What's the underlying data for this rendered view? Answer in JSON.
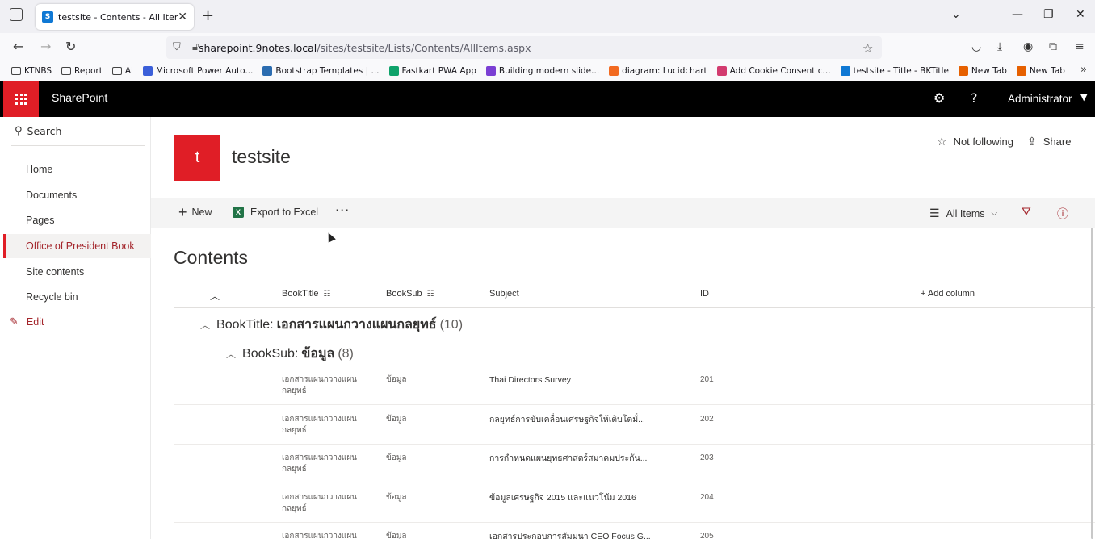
{
  "browser": {
    "tab_title": "testsite - Contents - All Items",
    "url_host": "sharepoint.9notes.local",
    "url_path": "/sites/testsite/Lists/Contents/AllItems.aspx",
    "bookmarks": [
      {
        "label": "KTNBS",
        "icon": "folder-icon",
        "color": ""
      },
      {
        "label": "Report",
        "icon": "folder-icon",
        "color": ""
      },
      {
        "label": "Ai",
        "icon": "folder-icon",
        "color": ""
      },
      {
        "label": "Microsoft Power Auto...",
        "icon": "power-automate-icon",
        "color": "#3b5fd9"
      },
      {
        "label": "Bootstrap Templates | ...",
        "icon": "bootstrap-icon",
        "color": "#2b6cb0"
      },
      {
        "label": "Fastkart PWA App",
        "icon": "fastkart-icon",
        "color": "#0fa36b"
      },
      {
        "label": "Building modern slide...",
        "icon": "slides-icon",
        "color": "#7b3fd4"
      },
      {
        "label": "diagram: Lucidchart",
        "icon": "lucidchart-icon",
        "color": "#f26a21"
      },
      {
        "label": "Add Cookie Consent c...",
        "icon": "cookie-icon",
        "color": "#d23b6f"
      },
      {
        "label": "testsite - Title - BKTitle",
        "icon": "sharepoint-icon",
        "color": "#0f78d4"
      },
      {
        "label": "New Tab",
        "icon": "firefox-icon",
        "color": "#e66000"
      },
      {
        "label": "New Tab",
        "icon": "firefox-icon",
        "color": "#e66000"
      }
    ]
  },
  "suite": {
    "brand": "SharePoint",
    "user": "Administrator",
    "accent": "#e01e26"
  },
  "nav": {
    "search_label": "Search",
    "items": [
      {
        "label": "Home",
        "active": false
      },
      {
        "label": "Documents",
        "active": false
      },
      {
        "label": "Pages",
        "active": false
      },
      {
        "label": "Office of President Book",
        "active": true
      },
      {
        "label": "Site contents",
        "active": false
      },
      {
        "label": "Recycle bin",
        "active": false
      }
    ],
    "edit_label": "Edit"
  },
  "site": {
    "logo_letter": "t",
    "title": "testsite",
    "follow_label": "Not following",
    "share_label": "Share"
  },
  "commands": {
    "new_label": "New",
    "export_label": "Export to Excel",
    "more_label": "···",
    "view_label": "All Items"
  },
  "list": {
    "title": "Contents",
    "columns": [
      "BookTitle",
      "BookSub",
      "Subject",
      "ID"
    ],
    "add_column_label": "+ Add column",
    "group1": {
      "field": "BookTitle:",
      "value": "เอกสารแผนกวางแผนกลยุทธ์",
      "count": "(10)"
    },
    "group2": {
      "field": "BookSub:",
      "value": "ข้อมูล",
      "count": "(8)"
    },
    "rows": [
      {
        "booktitle": "เอกสารแผนกวางแผน กลยุทธ์",
        "booksub": "ข้อมูล",
        "subject": "Thai Directors Survey",
        "id": "201"
      },
      {
        "booktitle": "เอกสารแผนกวางแผน กลยุทธ์",
        "booksub": "ข้อมูล",
        "subject": "กลยุทธ์การขับเคลื่อนเศรษฐกิจให้เติบโตมั่...",
        "id": "202"
      },
      {
        "booktitle": "เอกสารแผนกวางแผน กลยุทธ์",
        "booksub": "ข้อมูล",
        "subject": "การกำหนดแผนยุทธศาสตร์สมาคมประกัน...",
        "id": "203"
      },
      {
        "booktitle": "เอกสารแผนกวางแผน กลยุทธ์",
        "booksub": "ข้อมูล",
        "subject": "ข้อมูลเศรษฐกิจ 2015 และแนวโน้ม 2016",
        "id": "204"
      },
      {
        "booktitle": "เอกสารแผนกวางแผน",
        "booksub": "ข้อมูล",
        "subject": "เอกสารประกอบการสัมมนา CEO Focus G...",
        "id": "205"
      }
    ]
  }
}
